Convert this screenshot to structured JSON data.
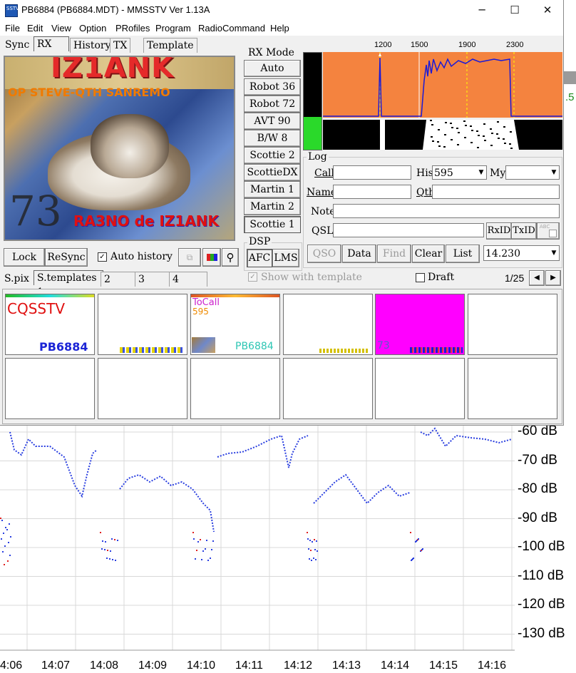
{
  "window": {
    "title": "PB6884 (PB6884.MDT) - MMSSTV Ver 1.13A",
    "minimize": "─",
    "maximize": "☐",
    "close": "✕"
  },
  "menu": [
    "File",
    "Edit",
    "View",
    "Option",
    "PRofiles",
    "Program",
    "RadioCommand",
    "Help"
  ],
  "tabs": [
    "Sync",
    "RX",
    "History",
    "TX",
    "Template"
  ],
  "image": {
    "callsign": "IZ1ANK",
    "info": "OP STEVE-QTH SANREMO",
    "big": "73",
    "signoff": "RA3NO de IZ1ANK"
  },
  "rx_mode": {
    "title": "RX Mode",
    "modes": [
      "Auto",
      "Robot 36",
      "Robot 72",
      "AVT 90",
      "B/W 8",
      "Scottie 2",
      "ScottieDX",
      "Martin 1",
      "Martin 2",
      "Scottie 1"
    ],
    "selected": "Scottie 1"
  },
  "dsp": {
    "title": "DSP",
    "afc": "AFC",
    "lms": "LMS"
  },
  "spectrum": {
    "freq_labels": [
      "1200",
      "1500",
      "1900",
      "2300"
    ],
    "bg_color": "#f4833f",
    "trace_color": "#1a1ad8",
    "level_color": "#2ad92a"
  },
  "rx_buttons": {
    "lock": "Lock",
    "resync": "ReSync",
    "auto_history": "Auto history",
    "auto_history_checked": true
  },
  "log": {
    "title": "Log",
    "call_label": "Call",
    "call_value": "",
    "his_label": "His",
    "his_value": "595",
    "my_label": "My",
    "my_value": "",
    "name_label": "Name",
    "name_value": "",
    "qth_label": "Qth",
    "qth_value": "",
    "note_label": "Note",
    "note_value": "",
    "qsl_label": "QSL",
    "qsl_value": "",
    "rxid": "RxID",
    "txid": "TxID",
    "qso": "QSO",
    "data": "Data",
    "find": "Find",
    "clear": "Clear",
    "list": "List",
    "freq": "14.230"
  },
  "bottom_tabs": [
    "S.pix",
    "S.templates 1",
    "2",
    "3",
    "4"
  ],
  "show_with_template": "Show with template",
  "draft": "Draft",
  "page_indicator": "1/25",
  "templates": [
    {
      "text1": "CQSSTV",
      "text2": "PB6884",
      "bg": "#ffffff"
    },
    {
      "text1": "",
      "text2": "",
      "bg": "#ffffff"
    },
    {
      "text1": "ToCall",
      "text2": "595",
      "text3": "PB6884",
      "bg": "#ffffff"
    },
    {
      "text1": "",
      "text2": "",
      "bg": "#ffffff"
    },
    {
      "text1": "73",
      "text2": "",
      "bg": "#ff00ff"
    },
    {
      "text1": "",
      "text2": "",
      "bg": "#ffffff"
    }
  ],
  "background_plot": {
    "db_labels": [
      "-60 dB",
      "-70 dB",
      "-80 dB",
      "-90 dB",
      "-100 dB",
      "-110 dB",
      "-120 dB",
      "-130 dB"
    ],
    "time_labels": [
      "4:06",
      "14:07",
      "14:08",
      "14:09",
      "14:10",
      "14:11",
      "14:12",
      "14:13",
      "14:14",
      "14:15",
      "14:16"
    ],
    "right_value": ".5"
  }
}
